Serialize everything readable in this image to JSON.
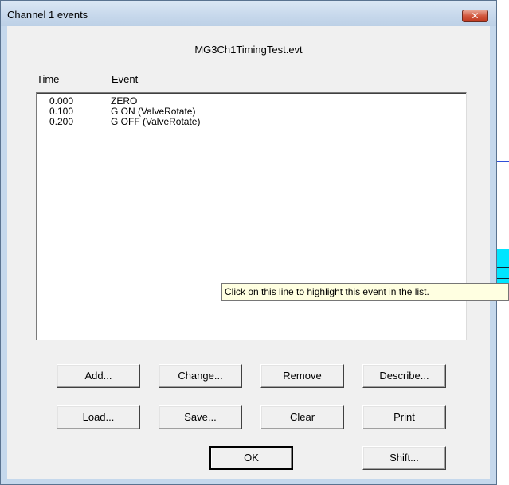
{
  "window": {
    "title": "Channel 1 events",
    "close_icon": "close-icon"
  },
  "file": {
    "name": "MG3Ch1TimingTest.evt"
  },
  "list": {
    "headers": {
      "time": "Time",
      "event": "Event"
    },
    "rows": [
      {
        "time": "0.000",
        "event": "ZERO"
      },
      {
        "time": "0.100",
        "event": "G ON (ValveRotate)"
      },
      {
        "time": "0.200",
        "event": "G OFF (ValveRotate)"
      }
    ]
  },
  "tooltip": {
    "text": "Click on this line to highlight this event in the list."
  },
  "buttons": {
    "add": "Add...",
    "change": "Change...",
    "remove": "Remove",
    "describe": "Describe...",
    "load": "Load...",
    "save": "Save...",
    "clear": "Clear",
    "print": "Print",
    "ok": "OK",
    "shift": "Shift..."
  },
  "colors": {
    "background_band": "#00e5ff",
    "background_line": "#2f4fd8",
    "tooltip_bg": "#ffffe1"
  }
}
